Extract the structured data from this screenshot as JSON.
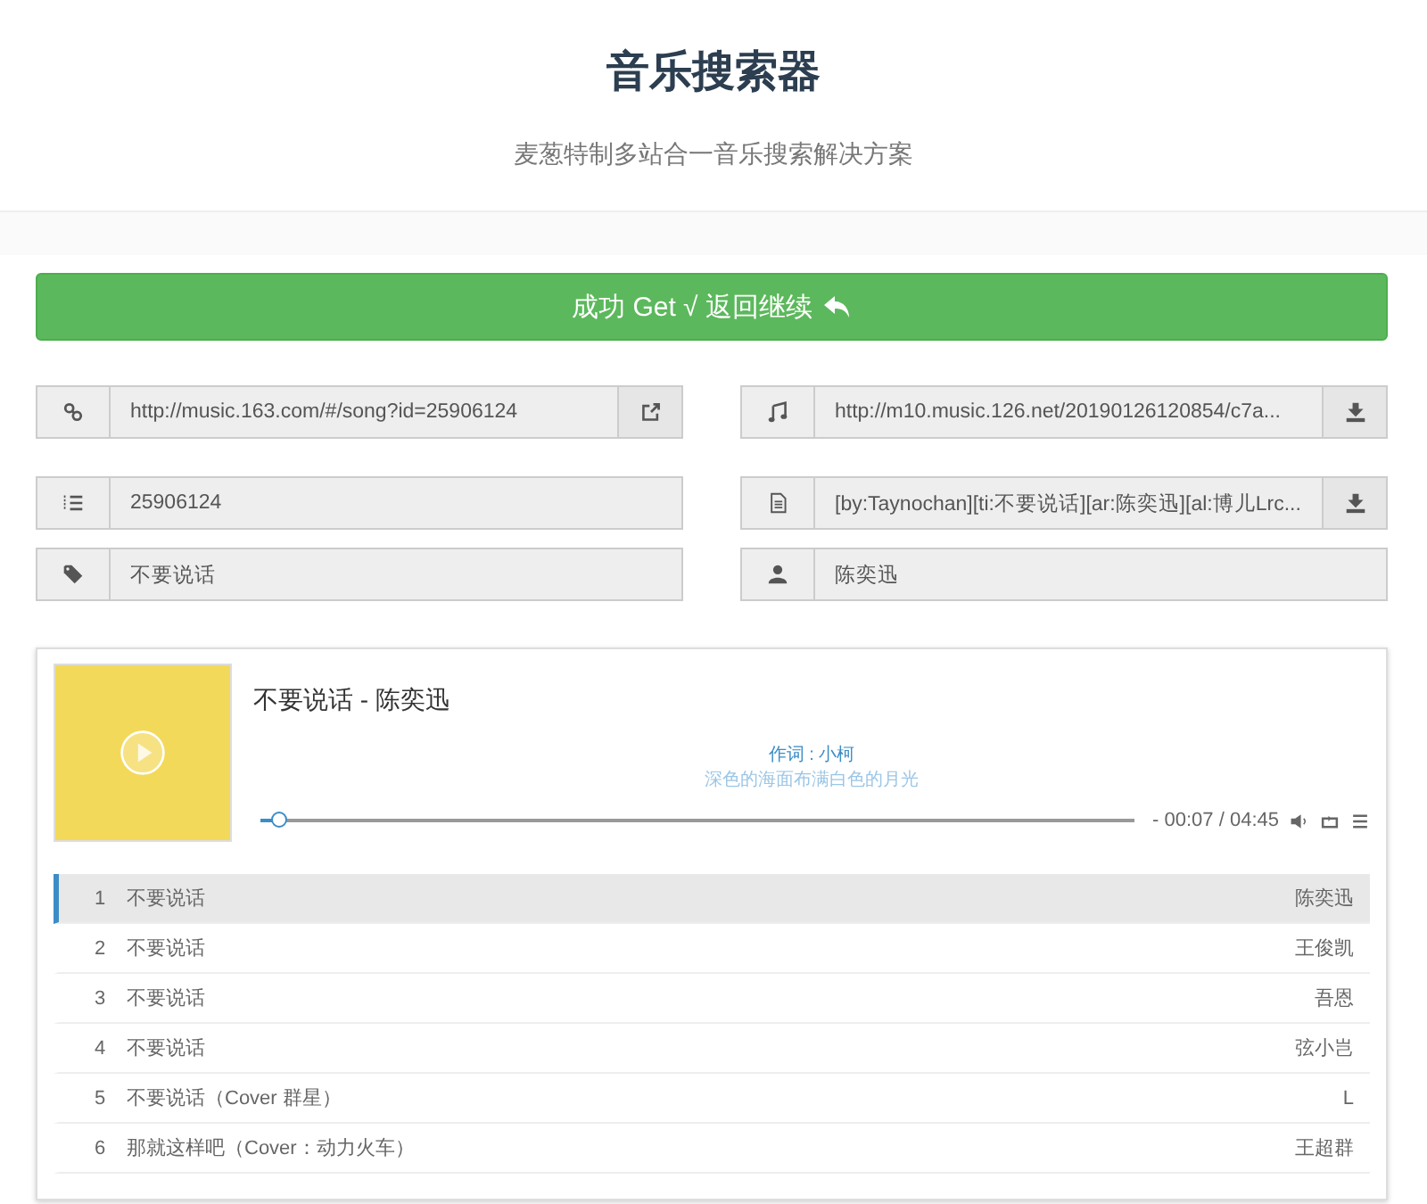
{
  "header": {
    "title": "音乐搜索器",
    "subtitle": "麦葱特制多站合一音乐搜索解决方案"
  },
  "back_button": {
    "label": "成功 Get √ 返回继续"
  },
  "fields": [
    {
      "kind": "link",
      "value": "http://music.163.com/#/song?id=25906124"
    },
    {
      "kind": "music",
      "value": "http://m10.music.126.net/20190126120854/c7a..."
    },
    {
      "kind": "id",
      "value": "25906124"
    },
    {
      "kind": "lyrics",
      "value": "[by:Taynochan][ti:不要说话][ar:陈奕迅][al:博儿Lrc..."
    },
    {
      "kind": "tag",
      "value": "不要说话"
    },
    {
      "kind": "artist",
      "value": "陈奕迅"
    }
  ],
  "player": {
    "title": "不要说话 - 陈奕迅",
    "lyrics": [
      "作词 : 小柯",
      "深色的海面布满白色的月光"
    ],
    "time": "- 00:07 / 04:45",
    "level": 0.02,
    "playlist": [
      {
        "number": "1",
        "title": "不要说话",
        "artist": "陈奕迅",
        "selected": true
      },
      {
        "number": "2",
        "title": "不要说话",
        "artist": "王俊凯",
        "selected": false
      },
      {
        "number": "3",
        "title": "不要说话",
        "artist": "吾恩",
        "selected": false
      },
      {
        "number": "4",
        "title": "不要说话",
        "artist": "弦小岂",
        "selected": false
      },
      {
        "number": "5",
        "title": "不要说话（Cover 群星）",
        "artist": "L",
        "selected": false
      },
      {
        "number": "6",
        "title": "那就这样吧（Cover：动力火车）",
        "artist": "王超群",
        "selected": false
      }
    ]
  }
}
